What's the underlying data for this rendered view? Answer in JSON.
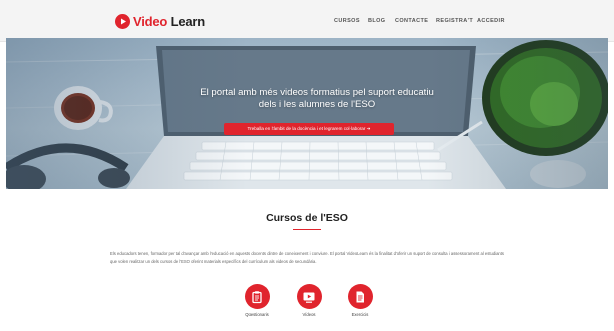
{
  "brand": {
    "accent_color": "#e0242d",
    "logo_icon": "play-icon",
    "logo_text_accent": "Video",
    "logo_text_main": " Learn"
  },
  "nav": {
    "items": [
      {
        "label": "CURSOS"
      },
      {
        "label": "BLOG"
      },
      {
        "label": "CONTACTE"
      },
      {
        "label": "REGISTRA'T"
      },
      {
        "label": "ACCEDIR"
      }
    ]
  },
  "hero": {
    "title_line1": "El portal amb més videos formatius pel suport educatiu",
    "title_line2": "dels i les alumnes de l'ESO",
    "button_label": "Treballa en l'àmbit de la docència i et legrarem col·laborar ➜"
  },
  "courses_section": {
    "title": "Cursos de l'ESO",
    "description": "Els educadors tenen, formador per tal d'avançar amb l'educació en aquests docents dintre de coneixement i conviure. El portal VideoLearn és la finalitat d'oferir un suport de consulta i assessorament al estudiants que volen realitzar un dels cursos de l'ESO oferint materials específics del currículum als videos de secundària.",
    "items": [
      {
        "label": "Qüestionaris",
        "icon": "clipboard-icon"
      },
      {
        "label": "Vídeos",
        "icon": "video-icon"
      },
      {
        "label": "Exercicis",
        "icon": "document-icon"
      }
    ]
  }
}
